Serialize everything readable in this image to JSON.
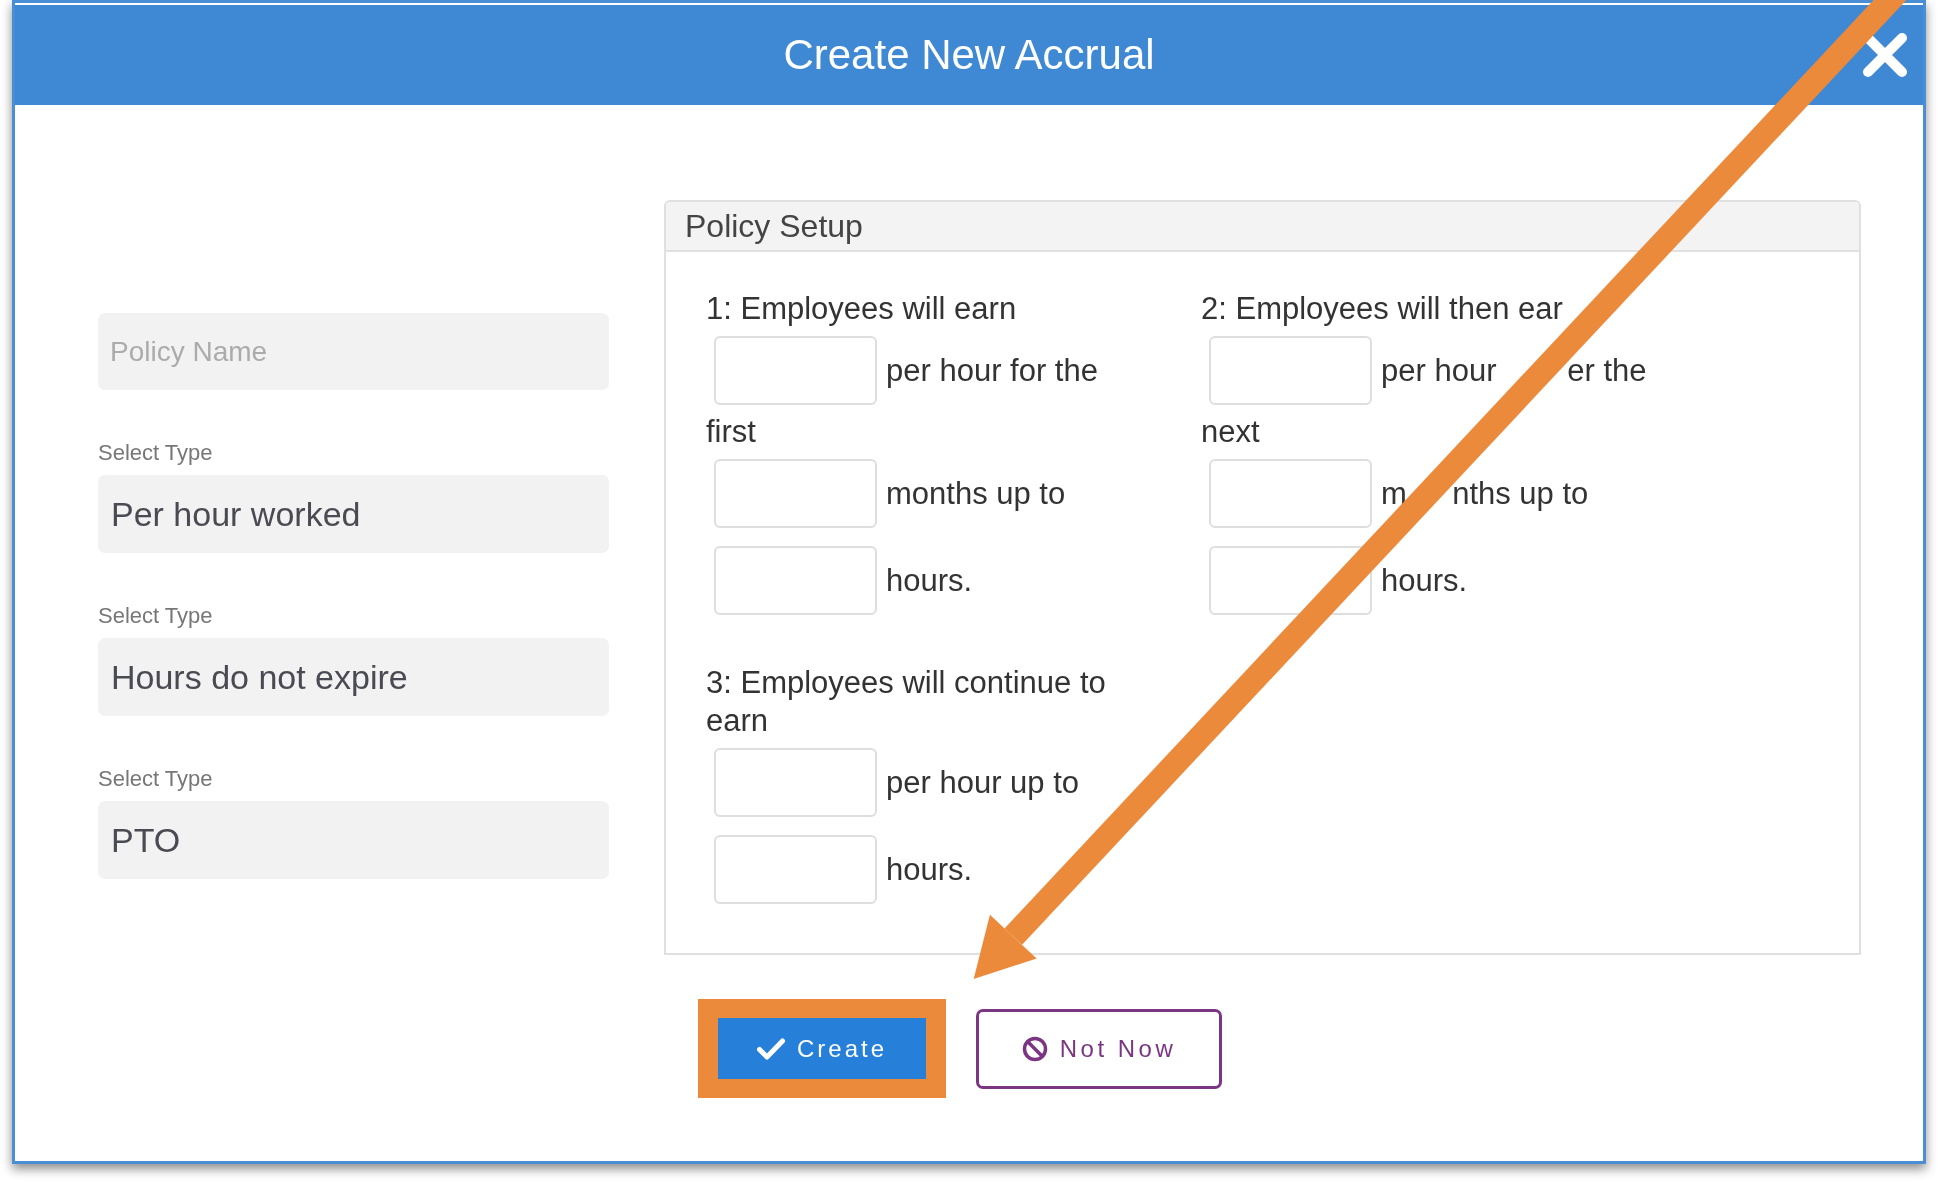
{
  "window": {
    "title": "Create New Accrual"
  },
  "policy_name": {
    "placeholder": "Policy Name"
  },
  "selects": [
    {
      "label": "Select Type",
      "value": "Per hour worked"
    },
    {
      "label": "Select Type",
      "value": "Hours do not expire"
    },
    {
      "label": "Select Type",
      "value": "PTO"
    }
  ],
  "policy_setup": {
    "title": "Policy Setup",
    "steps": [
      {
        "heading": "1: Employees will earn",
        "lines": [
          {
            "kind": "field",
            "labels": [
              "per hour for the"
            ]
          },
          {
            "kind": "text",
            "text": "first"
          },
          {
            "kind": "field",
            "labels": [
              "months up to"
            ]
          },
          {
            "kind": "field",
            "labels": [
              "hours."
            ]
          }
        ]
      },
      {
        "heading": "2: Employees will then ear",
        "lines": [
          {
            "kind": "field",
            "labels": [
              "per hour",
              "er the"
            ]
          },
          {
            "kind": "text",
            "text": "next"
          },
          {
            "kind": "field",
            "labels": [
              "m",
              "nths up to"
            ]
          },
          {
            "kind": "field",
            "labels": [
              "hours."
            ]
          }
        ]
      },
      {
        "heading": "3: Employees will continue to earn",
        "lines": [
          {
            "kind": "field",
            "labels": [
              "per hour up to"
            ]
          },
          {
            "kind": "field",
            "labels": [
              "hours."
            ]
          }
        ]
      }
    ]
  },
  "buttons": [
    {
      "kind": "primary",
      "label": "Create",
      "highlighted": true
    },
    {
      "kind": "secondary",
      "label": "Not Now"
    }
  ]
}
